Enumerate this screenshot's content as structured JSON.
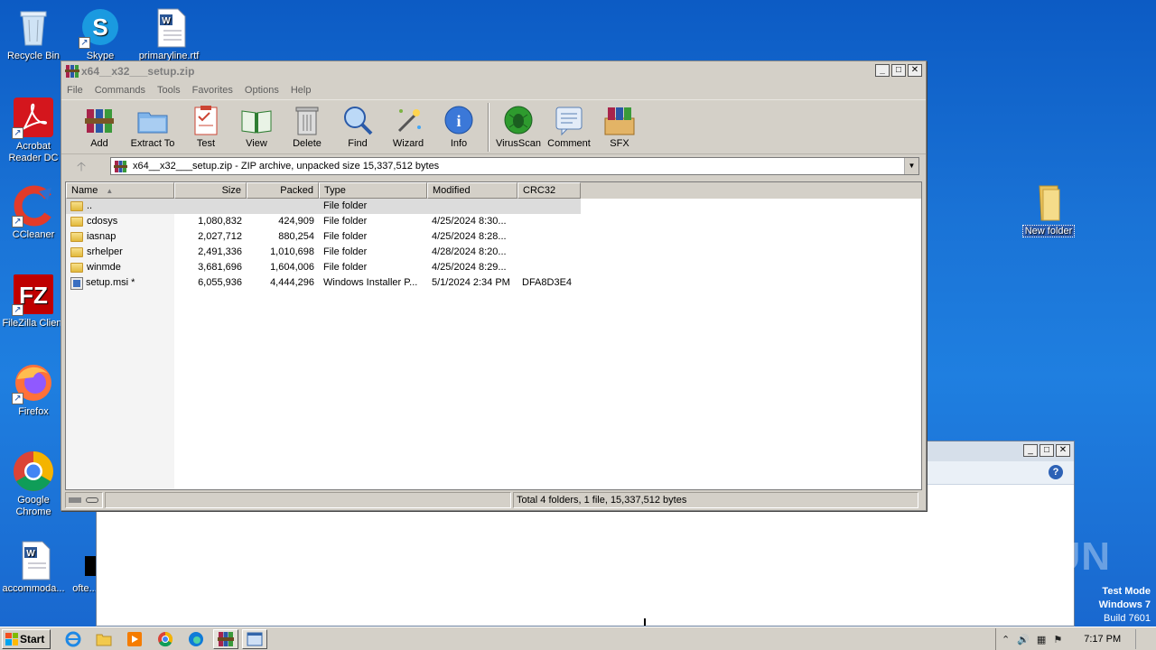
{
  "desktop": {
    "icons": [
      {
        "label": "Recycle Bin"
      },
      {
        "label": "Skype"
      },
      {
        "label": "primaryline.rtf"
      },
      {
        "label": "Acrobat Reader DC"
      },
      {
        "label": "CCleaner"
      },
      {
        "label": "FileZilla Client"
      },
      {
        "label": "Firefox"
      },
      {
        "label": "Google Chrome"
      },
      {
        "label": "accommoda..."
      },
      {
        "label": "ofte..."
      },
      {
        "label": "New folder"
      }
    ],
    "watermark": "ANY RUN",
    "test_mode": {
      "line1": "Test Mode",
      "line2": "Windows 7",
      "line3": "Build 7601"
    }
  },
  "window": {
    "title": "x64__x32___setup.zip",
    "controls": {
      "minimize": "_",
      "maximize": "□",
      "close": "✕"
    },
    "menu": [
      "File",
      "Commands",
      "Tools",
      "Favorites",
      "Options",
      "Help"
    ],
    "toolbar": [
      {
        "label": "Add",
        "icon": "add-archive-icon"
      },
      {
        "label": "Extract To",
        "icon": "extract-folder-icon"
      },
      {
        "label": "Test",
        "icon": "test-clipboard-icon"
      },
      {
        "label": "View",
        "icon": "view-book-icon"
      },
      {
        "label": "Delete",
        "icon": "delete-bin-icon"
      },
      {
        "label": "Find",
        "icon": "find-magnifier-icon"
      },
      {
        "label": "Wizard",
        "icon": "wizard-wand-icon"
      },
      {
        "label": "Info",
        "icon": "info-icon"
      },
      {
        "label": "VirusScan",
        "icon": "virus-scan-icon"
      },
      {
        "label": "Comment",
        "icon": "comment-icon"
      },
      {
        "label": "SFX",
        "icon": "sfx-icon"
      }
    ],
    "address": "x64__x32___setup.zip - ZIP archive, unpacked size 15,337,512 bytes",
    "columns": {
      "name": "Name",
      "size": "Size",
      "packed": "Packed",
      "type": "Type",
      "modified": "Modified",
      "crc": "CRC32"
    },
    "rows": [
      {
        "name": "..",
        "size": "",
        "packed": "",
        "type": "File folder",
        "modified": "",
        "crc": ""
      },
      {
        "name": "cdosys",
        "size": "1,080,832",
        "packed": "424,909",
        "type": "File folder",
        "modified": "4/25/2024 8:30...",
        "crc": ""
      },
      {
        "name": "iasnap",
        "size": "2,027,712",
        "packed": "880,254",
        "type": "File folder",
        "modified": "4/25/2024 8:28...",
        "crc": ""
      },
      {
        "name": "srhelper",
        "size": "2,491,336",
        "packed": "1,010,698",
        "type": "File folder",
        "modified": "4/28/2024 8:20...",
        "crc": ""
      },
      {
        "name": "winmde",
        "size": "3,681,696",
        "packed": "1,604,006",
        "type": "File folder",
        "modified": "4/25/2024 8:29...",
        "crc": ""
      },
      {
        "name": "setup.msi *",
        "size": "6,055,936",
        "packed": "4,444,296",
        "type": "Windows Installer P...",
        "modified": "5/1/2024 2:34 PM",
        "crc": "DFA8D3E4"
      }
    ],
    "status": "Total 4 folders, 1 file, 15,337,512 bytes"
  },
  "taskbar": {
    "start": "Start",
    "clock": "7:17 PM"
  }
}
